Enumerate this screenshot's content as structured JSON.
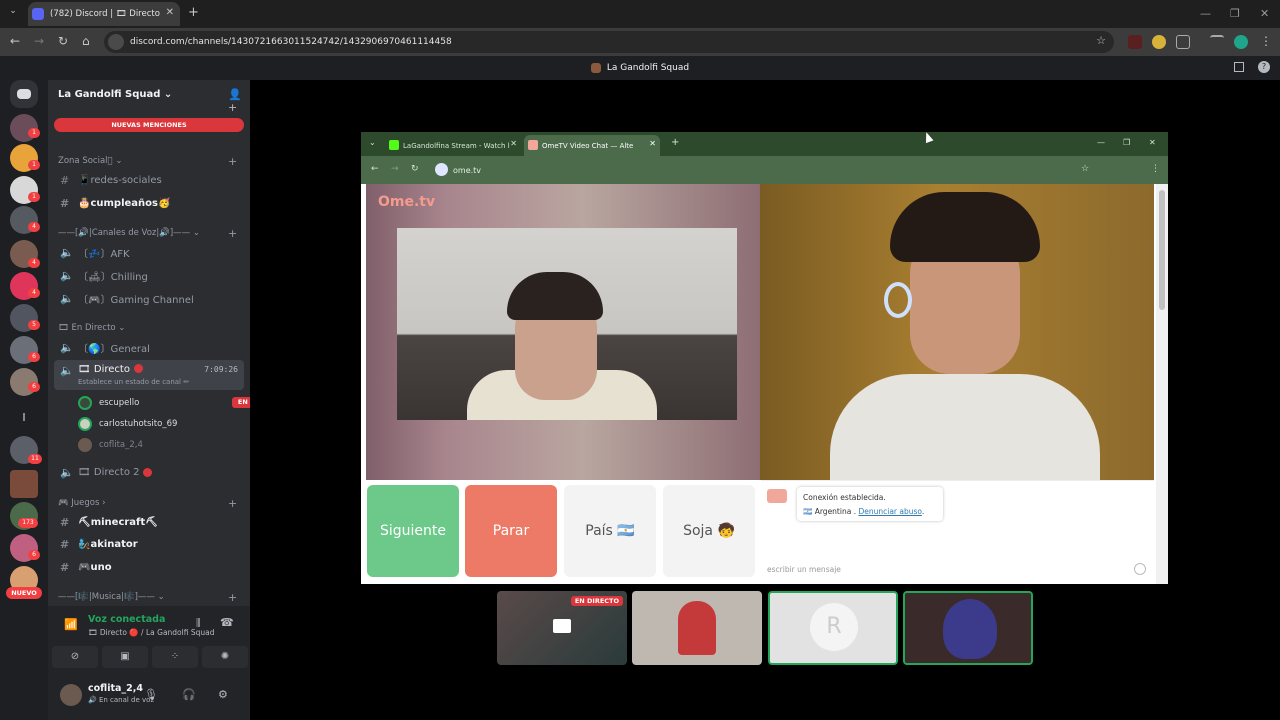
{
  "browser": {
    "tab_title": "(782) Discord | 🎞 Directo",
    "url": "discord.com/channels/1430721663011524742/1432906970461114458"
  },
  "discord_title": "La Gandolfi Squad",
  "server": {
    "name": "La Gandolfi Squad",
    "mentions_banner": "NUEVAS MENCIONES",
    "nuevo_badge": "NUEVO"
  },
  "rail_badges": [
    "1",
    "1",
    "1",
    "4",
    "4",
    "4",
    "5",
    "6",
    "6",
    "11",
    "173",
    "6"
  ],
  "categories": {
    "social": "Zona Social🏻",
    "voz": "——[🔊|Canales de Voz|🔊]——",
    "directo": "🎞 En Directo",
    "juegos": "🎮 Juegos",
    "musica": "——[🎼|Musica|🎼]——"
  },
  "channels": {
    "redes": "📱redes-sociales",
    "cumple": "🎂cumpleaños🥳",
    "afk": "〔💤〕AFK",
    "chilling": "〔🛋〕Chilling",
    "gaming": "〔🎮〕Gaming Channel",
    "general": "〔🌎〕General",
    "directo": "🎞 Directo",
    "directo_time": "7:09:26",
    "directo_sub": "Establece un estado de canal ✏",
    "directo2": "🎞 Directo 2",
    "minecraft": "⛏minecraft⛏",
    "akinator": "🧞akinator",
    "uno": "🎮uno"
  },
  "voice_users": [
    {
      "name": "escupello",
      "live": "EN DIRECTO"
    },
    {
      "name": "carlostuhotsito_69"
    },
    {
      "name": "coflita_2,4"
    }
  ],
  "voice_panel": {
    "title": "Voz conectada",
    "sub": "🎞 Directo 🔴 / La Gandolfi Squad"
  },
  "user_bar": {
    "name": "coflita_2,4",
    "status": "🔊 En canal de voz"
  },
  "stream": {
    "tab1": "LaGandolfina Stream - Watch l",
    "tab2": "OmeTV Video Chat — Alte",
    "url": "ome.tv",
    "logo": "Ome.tv",
    "buttons": {
      "next": "Siguiente",
      "stop": "Parar",
      "country": "País 🇦🇷",
      "gender": "Soja 🧒"
    },
    "chat": {
      "line1": "Conexión establecida.",
      "country": "🇦🇷 Argentina .",
      "report": "Denunciar abuso",
      "placeholder": "escribir un mensaje"
    }
  },
  "tiles": {
    "live_label": "EN DIRECTO"
  },
  "colors": {
    "discord_bg": "#2b2d31",
    "rail_bg": "#1e1f22",
    "accent_red": "#da373c",
    "voice_green": "#23a55a",
    "siguiente": "#6cc98a",
    "parar": "#ec7a66"
  }
}
